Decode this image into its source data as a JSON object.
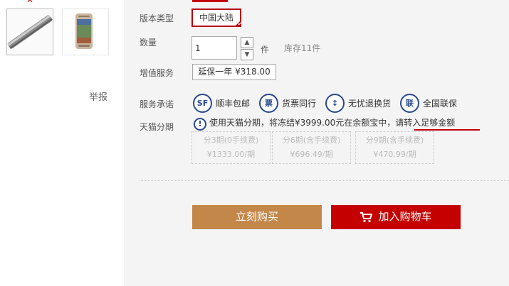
{
  "left": {
    "close_symbol": "✕",
    "report_link": "举报"
  },
  "labels": {
    "version": "版本类型",
    "quantity": "数量",
    "value_added": "增值服务",
    "service": "服务承诺",
    "installment": "天猫分期"
  },
  "version_option": "中国大陆",
  "quantity": {
    "value": "1",
    "unit": "件",
    "stock": "库存11件"
  },
  "vas_option": "延保一年 ¥318.00",
  "services": [
    {
      "icon": "SF",
      "label": "顺丰包邮"
    },
    {
      "icon": "票",
      "label": "货票同行"
    },
    {
      "icon": "↕",
      "label": "无忧退换货"
    },
    {
      "icon": "联",
      "label": "全国联保"
    }
  ],
  "installment_notice": "使用天猫分期，将冻结¥3999.00元在余额宝中，请转入足够金额",
  "installment_options": [
    {
      "term": "分3期(0手续费)",
      "amount": "¥1333.00/期"
    },
    {
      "term": "分6期(含手续费)",
      "amount": "¥696.49/期"
    },
    {
      "term": "分9期(含手续费)",
      "amount": "¥470.99/期"
    }
  ],
  "buttons": {
    "buy_now": "立刻购买",
    "add_cart": "加入购物车"
  },
  "colors": {
    "accent_red": "#c40000",
    "buy_brown": "#c3874a",
    "icon_blue": "#27498d"
  }
}
